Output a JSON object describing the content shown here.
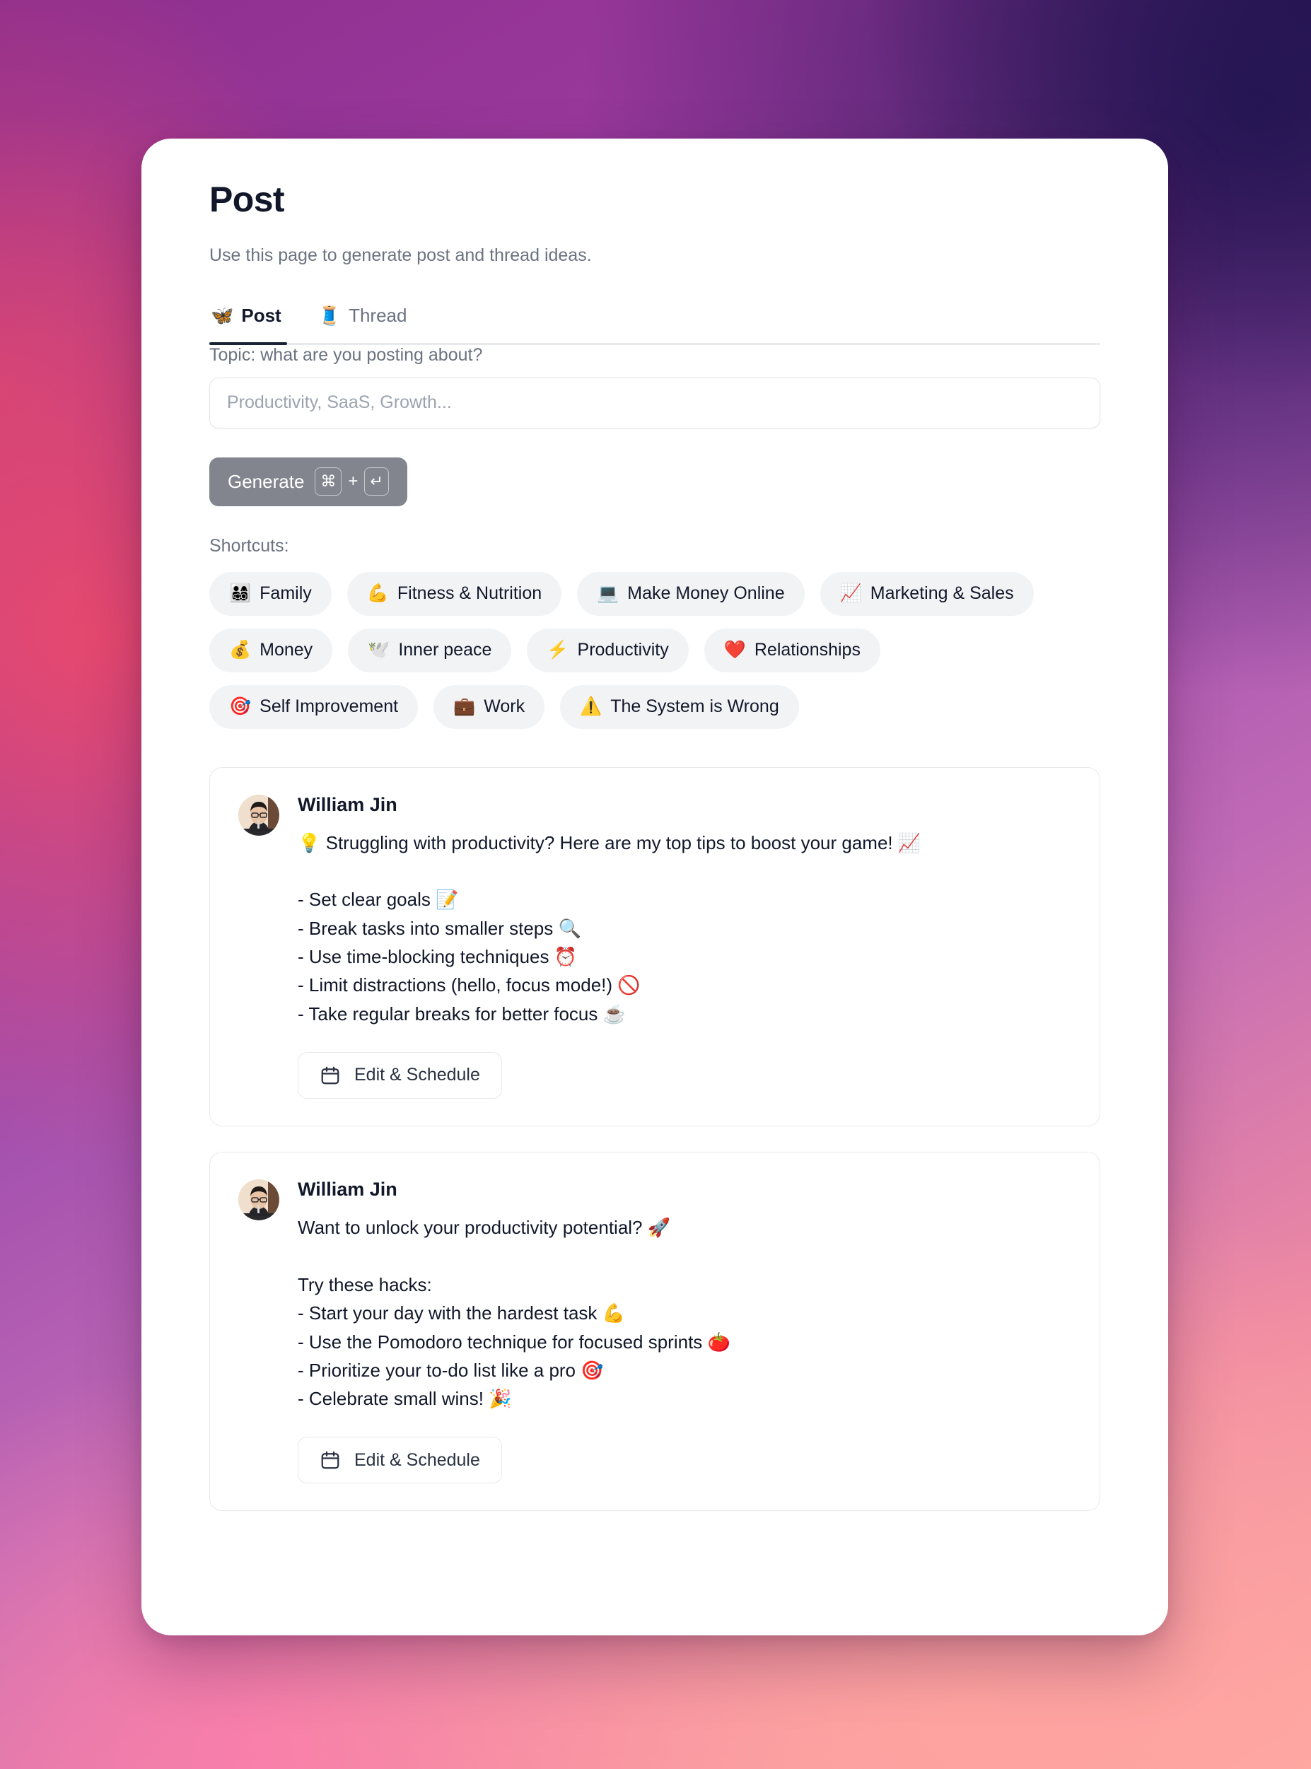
{
  "page": {
    "title": "Post",
    "subtitle": "Use this page to generate post and thread ideas."
  },
  "tabs": [
    {
      "emoji": "🦋",
      "label": "Post",
      "active": true
    },
    {
      "emoji": "🧵",
      "label": "Thread",
      "active": false
    }
  ],
  "form": {
    "topic_label": "Topic: what are you posting about?",
    "topic_value": "",
    "topic_placeholder": "Productivity, SaaS, Growth...",
    "generate_label": "Generate",
    "generate_kbd_meta": "⌘",
    "generate_kbd_plus": "+",
    "generate_kbd_enter": "↵"
  },
  "shortcuts": {
    "label": "Shortcuts:",
    "chips": [
      {
        "emoji": "👨‍👩‍👧‍👦",
        "label": "Family"
      },
      {
        "emoji": "💪",
        "label": "Fitness & Nutrition"
      },
      {
        "emoji": "💻",
        "label": "Make Money Online"
      },
      {
        "emoji": "📈",
        "label": "Marketing & Sales"
      },
      {
        "emoji": "💰",
        "label": "Money"
      },
      {
        "emoji": "🕊️",
        "label": "Inner peace"
      },
      {
        "emoji": "⚡",
        "label": "Productivity"
      },
      {
        "emoji": "❤️",
        "label": "Relationships"
      },
      {
        "emoji": "🎯",
        "label": "Self Improvement"
      },
      {
        "emoji": "💼",
        "label": "Work"
      },
      {
        "emoji": "⚠️",
        "label": "The System is Wrong"
      }
    ]
  },
  "results": [
    {
      "author": "William Jin",
      "text": "💡 Struggling with productivity? Here are my top tips to boost your game! 📈\n\n- Set clear goals 📝\n- Break tasks into smaller steps 🔍\n- Use time-blocking techniques ⏰\n- Limit distractions (hello, focus mode!) 🚫\n- Take regular breaks for better focus ☕",
      "edit_label": "Edit & Schedule"
    },
    {
      "author": "William Jin",
      "text": "Want to unlock your productivity potential? 🚀\n\nTry these hacks:\n- Start your day with the hardest task 💪\n- Use the Pomodoro technique for focused sprints 🍅\n- Prioritize your to-do list like a pro 🎯\n- Celebrate small wins! 🎉",
      "edit_label": "Edit & Schedule"
    }
  ],
  "colors": {
    "accent_dark": "#1b2335",
    "generate_bg": "#82858e",
    "chip_bg": "#f2f3f5",
    "muted_text": "#6b7280"
  }
}
